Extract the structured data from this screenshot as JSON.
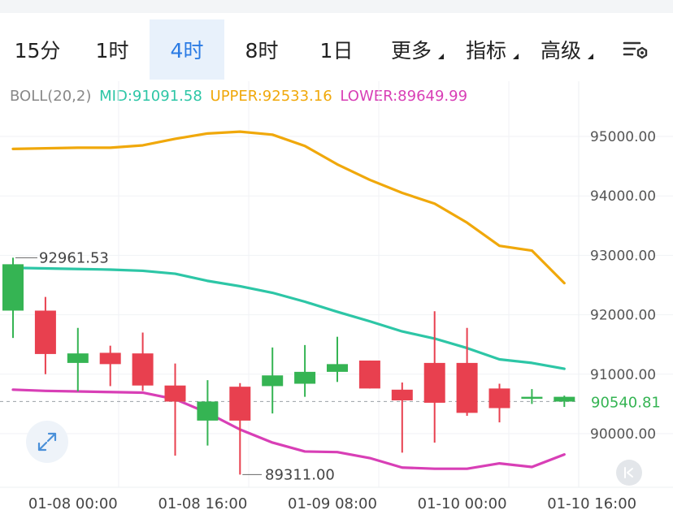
{
  "tabs": [
    {
      "label": "15分",
      "active": false,
      "dropdown": false
    },
    {
      "label": "1时",
      "active": false,
      "dropdown": false
    },
    {
      "label": "4时",
      "active": true,
      "dropdown": false
    },
    {
      "label": "8时",
      "active": false,
      "dropdown": false
    },
    {
      "label": "1日",
      "active": false,
      "dropdown": false
    },
    {
      "label": "更多",
      "active": false,
      "dropdown": true
    },
    {
      "label": "指标",
      "active": false,
      "dropdown": true
    },
    {
      "label": "高级",
      "active": false,
      "dropdown": true
    }
  ],
  "settings_icon": "chart-settings-icon",
  "indicator": {
    "name": "BOLL(20,2)",
    "mid": "MID:91091.58",
    "upper": "UPPER:92533.16",
    "lower": "LOWER:89649.99"
  },
  "colors": {
    "accent": "#2a7be4",
    "mid": "#2dc6a6",
    "upper": "#f0a80b",
    "lower": "#d83fb6",
    "up": "#35b453",
    "down": "#e8404f",
    "price_label": "#35b453"
  },
  "icons": {
    "expand": "expand-icon",
    "back": "collapse-left-icon"
  },
  "chart_data": {
    "type": "candlestick",
    "interval": "4h",
    "y_ticks": [
      95000,
      94000,
      93000,
      92000,
      91000,
      90000
    ],
    "y_tick_labels": [
      "95000.00",
      "94000.00",
      "93000.00",
      "92000.00",
      "91000.00",
      "90000.00"
    ],
    "ylim": [
      89100,
      96000
    ],
    "x_labels": [
      {
        "index": 2,
        "label": "01-08 00:00"
      },
      {
        "index": 6,
        "label": "01-08 16:00"
      },
      {
        "index": 10,
        "label": "01-09 08:00"
      },
      {
        "index": 14,
        "label": "01-10 00:00"
      },
      {
        "index": 18,
        "label": "01-10 16:00"
      }
    ],
    "candles": [
      {
        "open": 92070,
        "close": 92850,
        "high": 92960,
        "low": 91610
      },
      {
        "open": 92070,
        "close": 91340,
        "high": 92300,
        "low": 91000
      },
      {
        "open": 91190,
        "close": 91350,
        "high": 91780,
        "low": 90710
      },
      {
        "open": 91360,
        "close": 91170,
        "high": 91480,
        "low": 90800
      },
      {
        "open": 91350,
        "close": 90810,
        "high": 91700,
        "low": 90720
      },
      {
        "open": 90810,
        "close": 90540,
        "high": 91180,
        "low": 89630
      },
      {
        "open": 90220,
        "close": 90540,
        "high": 90900,
        "low": 89800
      },
      {
        "open": 90790,
        "close": 90220,
        "high": 90850,
        "low": 89311
      },
      {
        "open": 90800,
        "close": 90980,
        "high": 91450,
        "low": 90340
      },
      {
        "open": 90840,
        "close": 91040,
        "high": 91490,
        "low": 90620
      },
      {
        "open": 91040,
        "close": 91170,
        "high": 91630,
        "low": 90870
      },
      {
        "open": 91230,
        "close": 90760,
        "high": 91230,
        "low": 90760
      },
      {
        "open": 90740,
        "close": 90560,
        "high": 90860,
        "low": 89680
      },
      {
        "open": 91190,
        "close": 90520,
        "high": 92060,
        "low": 89850
      },
      {
        "open": 91190,
        "close": 90350,
        "high": 91780,
        "low": 90300
      },
      {
        "open": 90760,
        "close": 90430,
        "high": 90840,
        "low": 90190
      },
      {
        "open": 90620,
        "close": 90620,
        "high": 90750,
        "low": 90500
      },
      {
        "open": 90540,
        "close": 90620,
        "high": 90640,
        "low": 90450
      }
    ],
    "boll": {
      "upper": [
        94790,
        94800,
        94810,
        94810,
        94850,
        94960,
        95050,
        95080,
        95030,
        94840,
        94530,
        94270,
        94050,
        93870,
        93550,
        93160,
        93080,
        92533.16
      ],
      "mid": [
        92790,
        92780,
        92770,
        92760,
        92740,
        92690,
        92570,
        92480,
        92370,
        92220,
        92050,
        91890,
        91720,
        91600,
        91440,
        91250,
        91190,
        91091.58
      ],
      "lower": [
        90740,
        90720,
        90710,
        90700,
        90690,
        90580,
        90350,
        90070,
        89850,
        89700,
        89690,
        89590,
        89430,
        89410,
        89410,
        89500,
        89440,
        89649.99
      ]
    },
    "high_label": "92961.53",
    "low_label": "89311.00",
    "current_price": 90540.81,
    "current_price_label": "90540.81"
  }
}
